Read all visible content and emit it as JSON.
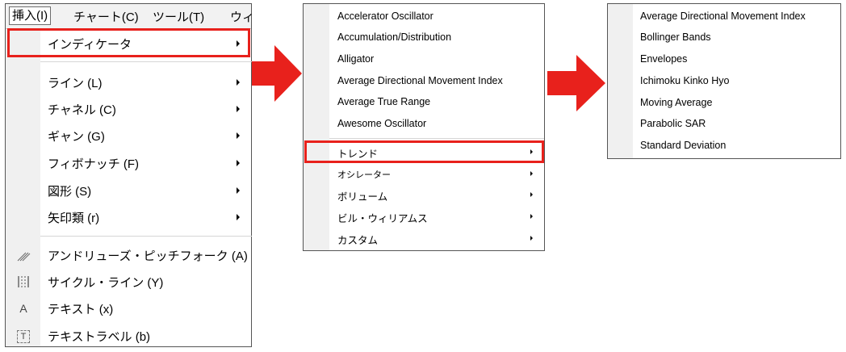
{
  "menubar": {
    "items": [
      {
        "label": "挿入(I)"
      },
      {
        "label": "チャート(C)"
      },
      {
        "label": "ツール(T)"
      },
      {
        "label": "ウィ"
      }
    ]
  },
  "insert_menu": {
    "items": [
      {
        "label": "インディケータ",
        "icon": ""
      },
      {
        "label": "ライン (L)",
        "icon": ""
      },
      {
        "label": "チャネル (C)",
        "icon": ""
      },
      {
        "label": "ギャン (G)",
        "icon": ""
      },
      {
        "label": "フィボナッチ (F)",
        "icon": ""
      },
      {
        "label": "図形 (S)",
        "icon": ""
      },
      {
        "label": "矢印類 (r)",
        "icon": ""
      },
      {
        "label": "アンドリューズ・ピッチフォーク (A)",
        "icon": "pitchfork-icon"
      },
      {
        "label": "サイクル・ライン (Y)",
        "icon": "cycle-lines-icon"
      },
      {
        "label": "テキスト (x)",
        "icon": "text-icon",
        "glyph": "A"
      },
      {
        "label": "テキストラベル (b)",
        "icon": "text-label-icon",
        "glyph": "T"
      }
    ]
  },
  "indicator_menu": {
    "items": [
      {
        "label": "Accelerator Oscillator"
      },
      {
        "label": "Accumulation/Distribution"
      },
      {
        "label": "Alligator"
      },
      {
        "label": "Average Directional Movement Index"
      },
      {
        "label": "Average True Range"
      },
      {
        "label": "Awesome Oscillator"
      },
      {
        "label": "トレンド"
      },
      {
        "label": "オシレーター"
      },
      {
        "label": "ボリューム"
      },
      {
        "label": "ビル・ウィリアムス"
      },
      {
        "label": "カスタム"
      }
    ]
  },
  "trend_menu": {
    "items": [
      {
        "label": "Average Directional Movement Index"
      },
      {
        "label": "Bollinger Bands"
      },
      {
        "label": "Envelopes"
      },
      {
        "label": "Ichimoku Kinko Hyo"
      },
      {
        "label": "Moving Average"
      },
      {
        "label": "Parabolic SAR"
      },
      {
        "label": "Standard Deviation"
      }
    ]
  },
  "colors": {
    "highlight": "#e8211c",
    "gutter": "#f0f0f0",
    "arrow": "#e8211c"
  }
}
